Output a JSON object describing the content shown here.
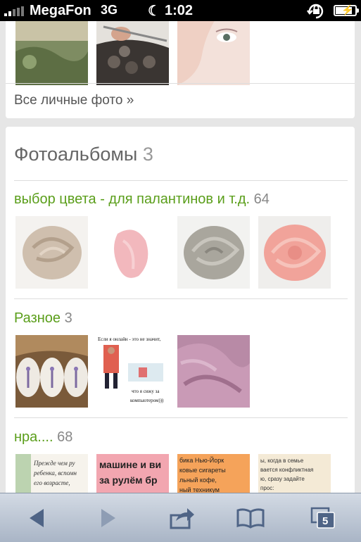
{
  "status_bar": {
    "carrier": "MegaFon",
    "network": "3G",
    "time": "1:02"
  },
  "personal_photos": {
    "link_label": "Все личные фото »"
  },
  "albums": {
    "title": "Фотоальбомы",
    "count": "3",
    "items": [
      {
        "name": "выбор цвета - для палантинов и т.д.",
        "count": "64"
      },
      {
        "name": "Разное",
        "count": "3"
      },
      {
        "name": "нра....",
        "count": "68"
      }
    ],
    "thumb_captions": {
      "computer_top": "Если я онлайн - это не значит,",
      "computer_mid": "что я сижу за",
      "computer_bot": "компьютером)))",
      "n1_lines": [
        "Прежде чем ру",
        "ребенка, вспомн",
        "его возрасте,"
      ],
      "n2_lines": [
        "машине и ви",
        "за рулём бр"
      ],
      "n3_lines": [
        "бика Нью-Йорк",
        "ковые сигареты",
        "льный кофе,",
        "ный техникум"
      ],
      "n4_lines": [
        "ы, когда в семье",
        "вается конфликтная",
        "ю, сразу задайте",
        "прос:"
      ]
    }
  },
  "toolbar": {
    "tabs_count": "5"
  },
  "colors": {
    "link_green": "#5a9e1a",
    "count_gray": "#888888",
    "toolbar_top": "#d3dae4",
    "toolbar_bottom": "#a9b5c6"
  }
}
